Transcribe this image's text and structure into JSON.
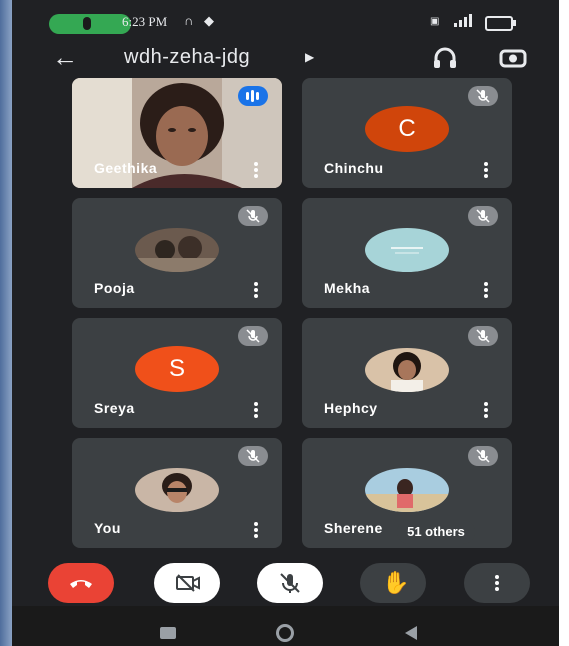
{
  "status_bar": {
    "time": "6:23 PM",
    "icons": [
      "mic-icon",
      "headphones-icon",
      "shield-icon",
      "volte-icon",
      "signal-icon",
      "battery-icon"
    ]
  },
  "meeting": {
    "title": "wdh-zeha-jdg",
    "icons": [
      "back-arrow-icon",
      "caret-right-icon",
      "headphones-icon",
      "switch-camera-icon"
    ]
  },
  "participants": [
    {
      "name": "Geethika",
      "state": "speaking",
      "avatar_type": "video"
    },
    {
      "name": "Chinchu",
      "state": "muted",
      "avatar_type": "letter",
      "letter": "C",
      "color": "#d0450b"
    },
    {
      "name": "Pooja",
      "state": "muted",
      "avatar_type": "photo"
    },
    {
      "name": "Mekha",
      "state": "muted",
      "avatar_type": "photo"
    },
    {
      "name": "Sreya",
      "state": "muted",
      "avatar_type": "letter",
      "letter": "S",
      "color": "#f0501a"
    },
    {
      "name": "Hephcy",
      "state": "muted",
      "avatar_type": "photo"
    },
    {
      "name": "You",
      "state": "muted",
      "avatar_type": "photo"
    },
    {
      "name": "Sherene",
      "state": "muted",
      "avatar_type": "photo"
    }
  ],
  "others_label": "51 others",
  "controls": [
    "end-call-button",
    "camera-off-button",
    "mic-off-button",
    "raise-hand-button",
    "more-options-button"
  ],
  "colors": {
    "background": "#202124",
    "tile": "#3c4043",
    "end_call": "#ea4335",
    "speaking": "#1a73e8"
  }
}
